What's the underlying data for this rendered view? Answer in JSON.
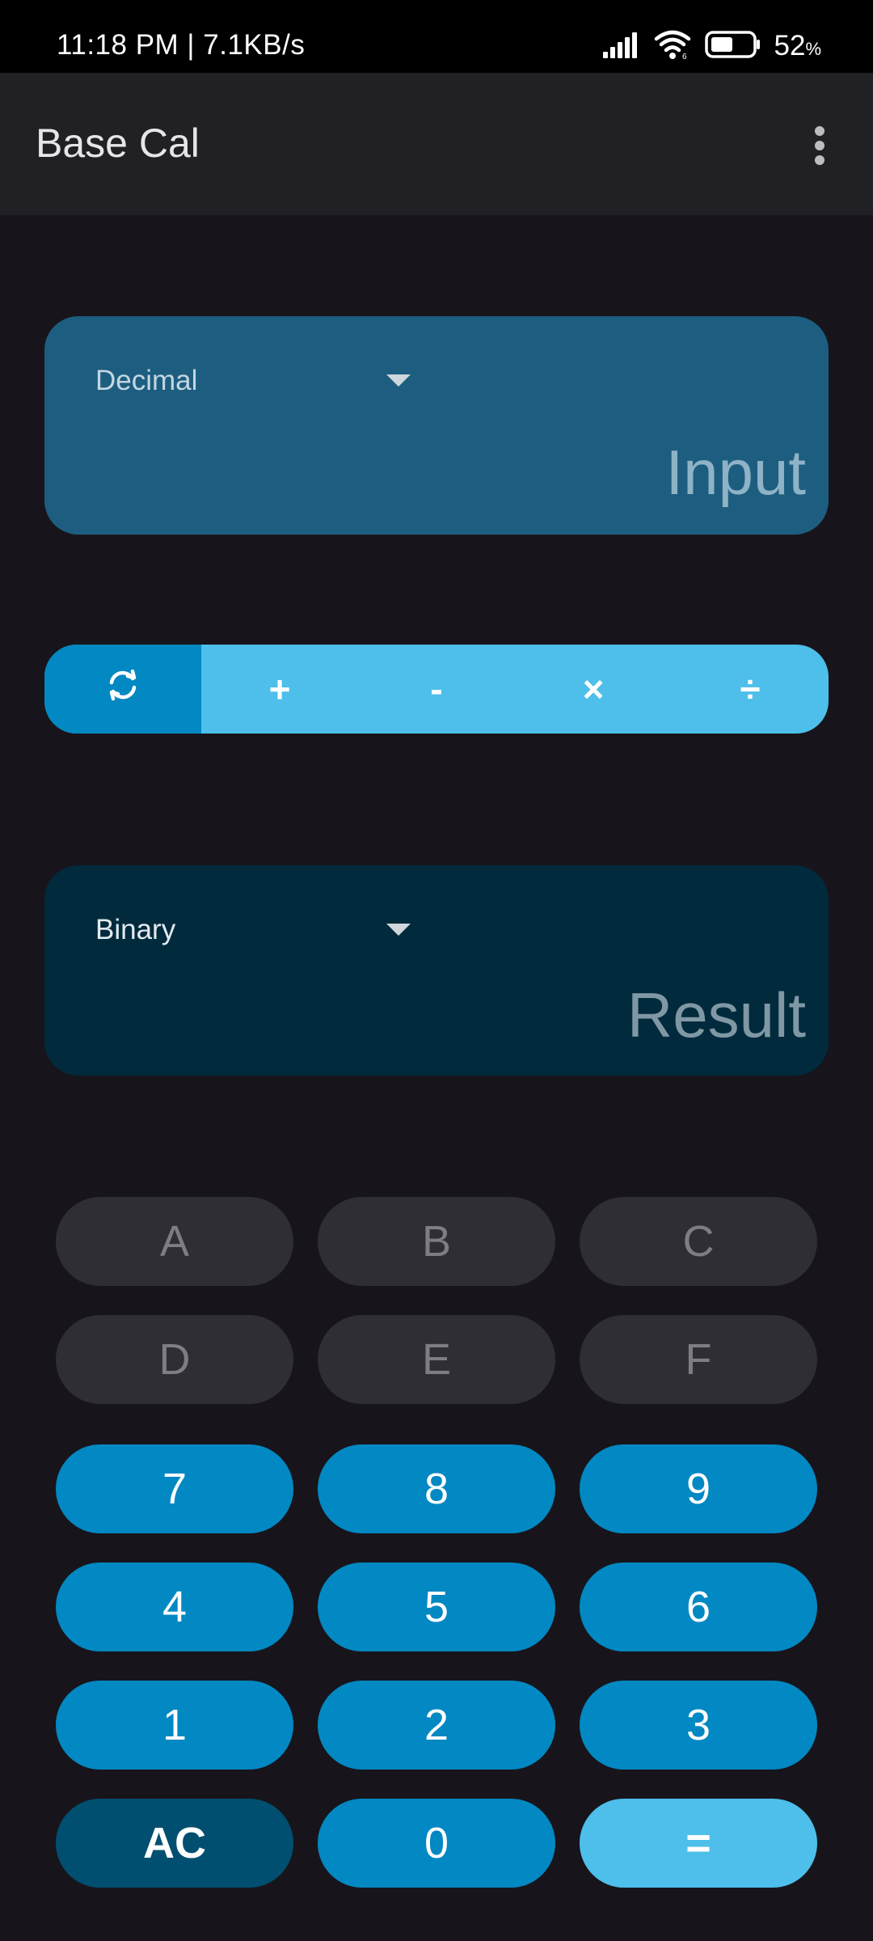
{
  "status_bar": {
    "time_speed": "11:18 PM | 7.1KB/s",
    "battery_percent": "52",
    "battery_unit": "%",
    "icons": [
      "signal-icon",
      "wifi-icon",
      "battery-icon"
    ]
  },
  "app_bar": {
    "title": "Base Cal",
    "menu_icon": "overflow-menu-icon"
  },
  "input_card": {
    "base_selected": "Decimal",
    "placeholder": "Input"
  },
  "operators": {
    "swap_icon": "swap-icon",
    "plus": "+",
    "minus": "-",
    "multiply": "×",
    "divide": "÷"
  },
  "result_card": {
    "base_selected": "Binary",
    "placeholder": "Result"
  },
  "keypad": {
    "hex_row1": [
      "A",
      "B",
      "C"
    ],
    "hex_row2": [
      "D",
      "E",
      "F"
    ],
    "row7": [
      "7",
      "8",
      "9"
    ],
    "row4": [
      "4",
      "5",
      "6"
    ],
    "row1": [
      "1",
      "2",
      "3"
    ],
    "bottom": [
      "AC",
      "0",
      "="
    ]
  },
  "colors": {
    "background": "#17151b",
    "app_bar": "#212025",
    "input_card": "#1d5e80",
    "result_card": "#012a3d",
    "accent": "#0288c2",
    "accent_light": "#4dbfea",
    "ac_key": "#004f70",
    "disabled_key": "#2f2e34"
  }
}
